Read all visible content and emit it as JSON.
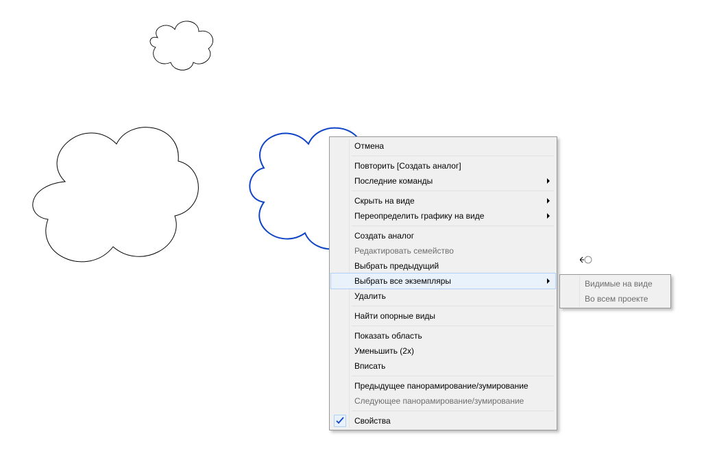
{
  "contextMenu": {
    "items": [
      {
        "label": "Отмена",
        "hasSubmenu": false
      },
      {
        "sep": true
      },
      {
        "label": "Повторить [Создать аналог]",
        "hasSubmenu": false
      },
      {
        "label": "Последние команды",
        "hasSubmenu": true
      },
      {
        "sep": true
      },
      {
        "label": "Скрыть на виде",
        "hasSubmenu": true
      },
      {
        "label": "Переопределить графику на виде",
        "hasSubmenu": true
      },
      {
        "sep": true
      },
      {
        "label": "Создать аналог",
        "hasSubmenu": false
      },
      {
        "label": "Редактировать семейство",
        "hasSubmenu": false,
        "disabled": true
      },
      {
        "label": "Выбрать предыдущий",
        "hasSubmenu": false
      },
      {
        "label": "Выбрать все экземпляры",
        "hasSubmenu": true,
        "highlight": true
      },
      {
        "label": "Удалить",
        "hasSubmenu": false
      },
      {
        "sep": true
      },
      {
        "label": "Найти опорные виды",
        "hasSubmenu": false
      },
      {
        "sep": true
      },
      {
        "label": "Показать область",
        "hasSubmenu": false
      },
      {
        "label": "Уменьшить (2x)",
        "hasSubmenu": false
      },
      {
        "label": "Вписать",
        "hasSubmenu": false
      },
      {
        "sep": true
      },
      {
        "label": "Предыдущее панорамирование/зумирование",
        "hasSubmenu": false
      },
      {
        "label": "Следующее панорамирование/зумирование",
        "hasSubmenu": false,
        "disabled": true
      },
      {
        "sep": true
      },
      {
        "label": "Свойства",
        "hasSubmenu": false,
        "checked": true
      }
    ]
  },
  "submenu": {
    "items": [
      {
        "label": "Видимые на виде"
      },
      {
        "label": "Во всем проекте"
      }
    ]
  }
}
